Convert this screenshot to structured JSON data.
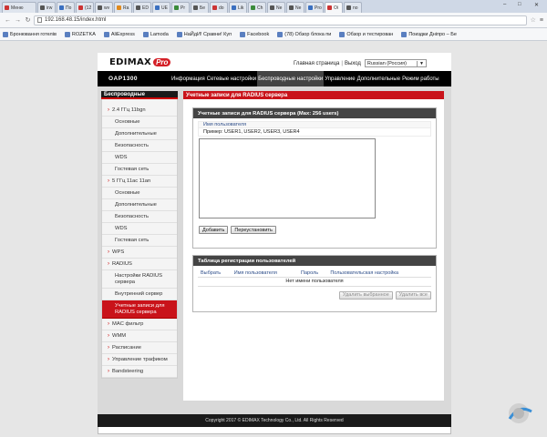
{
  "browser": {
    "tabs": [
      {
        "label": "Меню",
        "fav": "r",
        "active": false
      },
      {
        "label": "irw",
        "fav": "k",
        "active": false
      },
      {
        "label": "По",
        "fav": "b",
        "active": false
      },
      {
        "label": "(12",
        "fav": "r",
        "active": false
      },
      {
        "label": "wv",
        "fav": "k",
        "active": false
      },
      {
        "label": "Ra",
        "fav": "o",
        "active": false
      },
      {
        "label": "ED",
        "fav": "k",
        "active": false
      },
      {
        "label": "UE",
        "fav": "b",
        "active": false
      },
      {
        "label": "Pr",
        "fav": "g",
        "active": false
      },
      {
        "label": "Бе",
        "fav": "k",
        "active": false
      },
      {
        "label": "do",
        "fav": "r",
        "active": false
      },
      {
        "label": "Lik",
        "fav": "b",
        "active": false
      },
      {
        "label": "Ch",
        "fav": "g",
        "active": false
      },
      {
        "label": "Ne",
        "fav": "k",
        "active": false
      },
      {
        "label": "Ne",
        "fav": "k",
        "active": false
      },
      {
        "label": "Pro",
        "fav": "b",
        "active": false
      },
      {
        "label": "Oi",
        "fav": "r",
        "active": true
      },
      {
        "label": "no",
        "fav": "k",
        "active": false
      }
    ],
    "url": "192.168.48.15/index.html",
    "bookmarks": [
      "Бронювання готелів",
      "ROZETKA",
      "AliExpress",
      "Lamoda",
      "НаЙдИ! Сравни! Куп",
      "Facebook",
      "(78) Обзор блока пи",
      "Обзор и тестирован",
      "Поиздки Дніпро – Бе"
    ]
  },
  "router": {
    "logo_text": "EDIMAX",
    "logo_badge": "Pro",
    "top_link_home": "Главная страница",
    "top_link_logout": "Выход",
    "language": "Russian (Россия)",
    "model": "OAP1300",
    "nav": [
      "Информация",
      "Сетевые настройки",
      "Беспроводные настройки",
      "Управление",
      "Дополнительные",
      "Режим работы"
    ],
    "sidebar": {
      "title": "Беспроводные",
      "items": [
        {
          "label": "2.4 ГГц 11bgn",
          "level": "top"
        },
        {
          "label": "Основные",
          "level": "sub"
        },
        {
          "label": "Дополнительные",
          "level": "sub"
        },
        {
          "label": "Безопасность",
          "level": "sub"
        },
        {
          "label": "WDS",
          "level": "sub"
        },
        {
          "label": "Гостевая сеть",
          "level": "sub"
        },
        {
          "label": "5 ГГц 11ac 11an",
          "level": "top"
        },
        {
          "label": "Основные",
          "level": "sub"
        },
        {
          "label": "Дополнительные",
          "level": "sub"
        },
        {
          "label": "Безопасность",
          "level": "sub"
        },
        {
          "label": "WDS",
          "level": "sub"
        },
        {
          "label": "Гостевая сеть",
          "level": "sub"
        },
        {
          "label": "WPS",
          "level": "top"
        },
        {
          "label": "RADIUS",
          "level": "top"
        },
        {
          "label": "Настройки RADIUS сервера",
          "level": "sub-tall"
        },
        {
          "label": "Внутренний сервер",
          "level": "sub"
        },
        {
          "label": "Учетные записи для RADIUS сервера",
          "level": "active"
        },
        {
          "label": "MAC фильтр",
          "level": "top"
        },
        {
          "label": "WMM",
          "level": "top"
        },
        {
          "label": "Расписание",
          "level": "top"
        },
        {
          "label": "Управление трафиком",
          "level": "top"
        },
        {
          "label": "Bandsteering",
          "level": "top"
        }
      ]
    },
    "content_title": "Учетные записи для RADIUS сервера",
    "accounts_panel": {
      "header": "Учетные записи для RADIUS сервера (Max: 256 users)",
      "field_label": "Имя пользователя",
      "example": "Пример: USER1, USER2, USER3, USER4",
      "textarea_value": "",
      "add_button": "Добавить",
      "reset_button": "Переустановить"
    },
    "table_panel": {
      "header": "Таблица регистрации пользователей",
      "columns": [
        "Выбрать",
        "Имя пользователя",
        "Пароль",
        "Пользовательская настройка"
      ],
      "empty_text": "Нет имени пользователя",
      "delete_selected": "Удалить выбранное",
      "delete_all": "Удалить все"
    },
    "footer": "Copyright 2017 © EDIMAX Technology Co., Ltd. All Rights Reserved"
  }
}
